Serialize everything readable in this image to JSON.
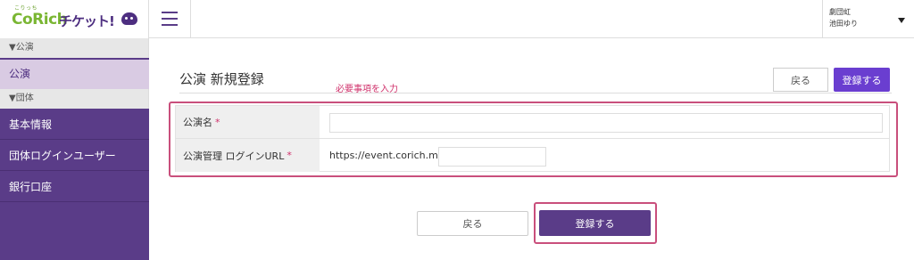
{
  "logo": {
    "ruby": "こりっち",
    "brand": "CoRich",
    "suffix": "チケット!"
  },
  "sidebar": {
    "section_performance": "▼公演",
    "active_item": "公演",
    "section_group": "▼団体",
    "items": [
      {
        "label": "基本情報"
      },
      {
        "label": "団体ログインユーザー"
      },
      {
        "label": "銀行口座"
      }
    ]
  },
  "topbar": {
    "org_name": "劇団虹",
    "user_name": "池田ゆり"
  },
  "main": {
    "title": "公演 新規登録",
    "hint": "必要事項を入力",
    "back_label": "戻る",
    "register_label": "登録する"
  },
  "form": {
    "name_label": "公演名",
    "url_label": "公演管理 ログインURL",
    "required_mark": "*",
    "url_prefix": "https://event.corich.me/",
    "name_value": "",
    "url_value": ""
  },
  "colors": {
    "sidebar": "#5a3c88",
    "accent_button": "#6a3ed0",
    "highlight": "#c94f7c",
    "required": "#d0316b",
    "logo_green": "#7ab633"
  }
}
